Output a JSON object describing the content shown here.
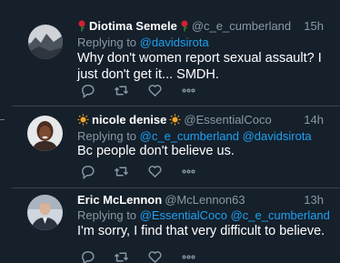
{
  "colors": {
    "background": "#15202b",
    "divider": "#38444d",
    "muted_text": "#8899a6",
    "link": "#1da1f2",
    "name_text": "#ffffff"
  },
  "tweets": [
    {
      "display_name": "Diotima Semele",
      "name_decoration_icon": "rose-icon",
      "handle": "@c_e_cumberland",
      "time": "15h",
      "replying_prefix": "Replying to",
      "replying_to": "@davidsirota",
      "text": "Why don't women report sexual assault? I just don't get it... SMDH."
    },
    {
      "display_name": "nicole denise",
      "name_decoration_icon": "sun-icon",
      "handle": "@EssentialCoco",
      "time": "14h",
      "replying_prefix": "Replying to",
      "replying_to": "@c_e_cumberland @davidsirota",
      "text": "Bc people don't believe us."
    },
    {
      "display_name": "Eric McLennon",
      "handle": "@McLennon63",
      "time": "13h",
      "replying_prefix": "Replying to",
      "replying_to": "@EssentialCoco @c_e_cumberland @da...",
      "text": "I'm sorry, I find that very difficult to believe."
    }
  ],
  "action_icons": [
    "reply-icon",
    "retweet-icon",
    "like-icon",
    "more-icon"
  ]
}
